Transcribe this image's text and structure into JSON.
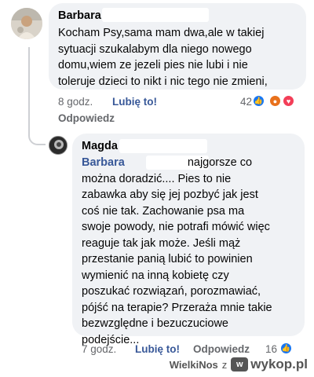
{
  "comment1": {
    "author": "Barbara",
    "lines": [
      "Kocham Psy,sama mam dwa,ale w takiej",
      "sytuacji szukalabym dla niego nowego",
      "domu,wiem ze jezeli pies nie lubi i nie",
      "toleruje  dzieci to nikt i nic tego nie zmieni,"
    ],
    "time": "8 godz.",
    "like": "Lubię to!",
    "reply": "Odpowiedz",
    "reaction_count": "42"
  },
  "comment2": {
    "author": "Magda",
    "mention": "Barbara",
    "first_line_rest": "najgorsze co",
    "lines": [
      "można doradzić.... Pies to nie",
      "zabawka aby się jej pozbyć jak jest",
      "coś nie tak. Zachowanie psa ma",
      "swoje powody, nie potrafi mówić więc",
      "reaguje tak jak może. Jeśli mąż",
      "przestanie panią lubić to powinien",
      "wymienić na inną kobietę czy",
      "poszukać rozwiązań, porozmawiać,",
      "pójść na terapie? Przeraża mnie takie",
      "bezwzględne i bezuczuciowe",
      "podejście..."
    ],
    "time": "7 godz.",
    "like": "Lubię to!",
    "reply": "Odpowiedz",
    "reaction_count": "16"
  },
  "watermark": {
    "user": "WielkiNos",
    "connector": "z",
    "site": "wykop.pl"
  },
  "colors": {
    "link": "#385898",
    "bubble": "#f0f2f5",
    "meta": "#65676b",
    "like_reaction": "#1877f2",
    "angry_reaction": "#e8711c",
    "love_reaction": "#f33e58"
  }
}
